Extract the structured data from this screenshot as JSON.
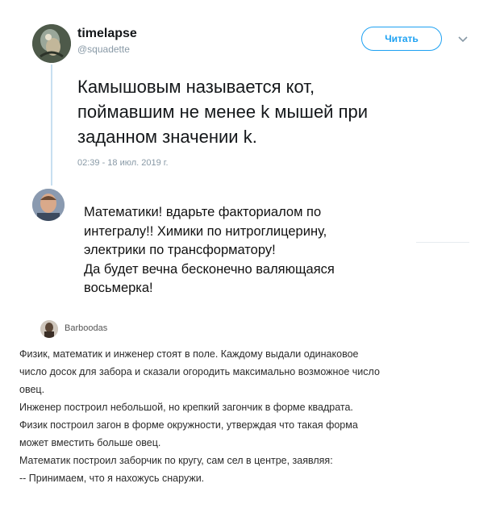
{
  "tweet": {
    "author_name": "timelapse",
    "author_handle": "@squadette",
    "follow_label": "Читать",
    "text_lines": [
      "Камышовым называется кот,",
      "поймавшим не менее k мышей при",
      "заданном значении k."
    ],
    "timestamp": "02:39 - 18 июл. 2019 г."
  },
  "reply": {
    "text_lines": [
      "Математики! вдарьте факториалом по",
      "интегралу!! Химики по нитроглицерину,",
      "электрики по трансформатору!",
      "Да будет вечна бесконечно валяющаяся",
      "восьмерка!"
    ]
  },
  "comment": {
    "author": "Barboodas",
    "text_lines": [
      "Физик, математик и инженер стоят в поле. Каждому выдали одинаковое",
      "число досок для забора и сказали огородить максимально возможное число",
      "овец.",
      "Инженер построил небольшой, но крепкий загончик в форме квадрата.",
      "Физик построил загон в форме окружности, утверждая что такая форма",
      "может вместить больше овец.",
      "Математик построил заборчик по кругу, сам сел в центре, заявляя:",
      "-- Принимаем, что я нахожусь снаружи."
    ]
  },
  "colors": {
    "accent": "#1da1f2",
    "muted": "#8899a6",
    "thread_line": "#c7dff0"
  },
  "icons": {
    "menu": "chevron-down-icon"
  }
}
